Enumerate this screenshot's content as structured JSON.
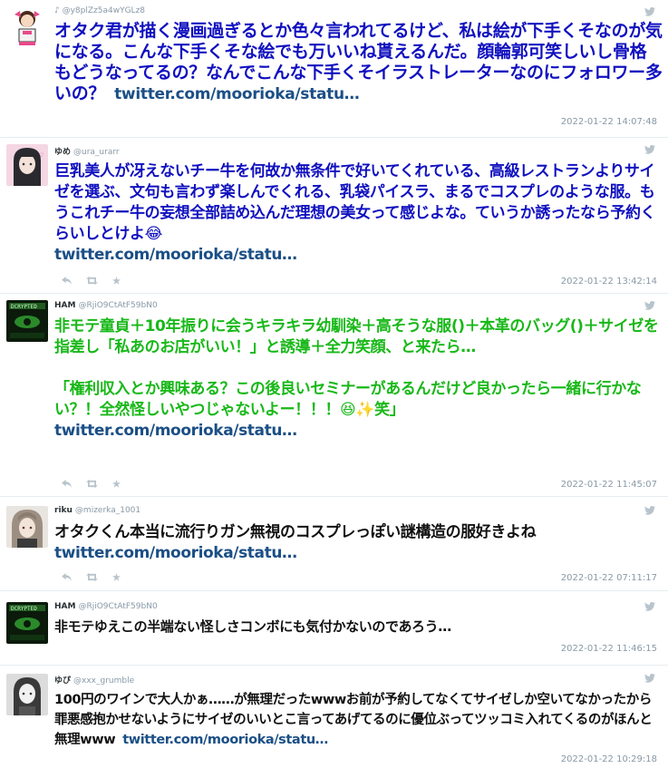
{
  "tweets": [
    {
      "name": "",
      "handle": "♪ @y8plZz5a4wYGLz8",
      "text": "オタク君が描く漫画過ぎるとか色々言われてるけど、私は絵が下手くそなのが気になる。こんな下手くそな絵でも万いいね貰えるんだ。顔輪郭可笑しいし骨格もどうなってるの？なんでこんな下手くそイラストレーターなのにフォロワー多いの？",
      "link": "twitter.com/moorioka/statu…",
      "time": "2022-01-22 14:07:48",
      "text_color": "#1010c0"
    },
    {
      "name": "ゆめ",
      "handle": "@ura_urarr",
      "text": "巨乳美人が冴えないチー牛を何故か無条件で好いてくれている、高級レストランよりサイゼを選ぶ、文句も言わず楽しんでくれる、乳袋パイスラ、まるでコスプレのような服。もうこれチー牛の妄想全部詰め込んだ理想の美女って感じよな。ていうか誘ったなら予約くらいしとけよ😂",
      "link": "twitter.com/moorioka/statu…",
      "time": "2022-01-22 13:42:14",
      "text_color": "#1010c0"
    },
    {
      "name": "HAM",
      "handle": "@RjiO9CtAtF59bN0",
      "text": "非モテ童貞＋10年振りに会うキラキラ幼馴染＋高そうな服()＋本革のバッグ()＋サイゼを指差し「私あのお店がいい！」と誘導＋全力笑顔、と来たら…",
      "text2": "「権利収入とか興味ある？この後良いセミナーがあるんだけど良かったら一緒に行かない？！全然怪しいやつじゃないよー！！！😆✨笑」",
      "link": "twitter.com/moorioka/statu…",
      "time": "2022-01-22 11:45:07",
      "text_color": "#18b818"
    },
    {
      "name": "riku",
      "handle": "@mizerka_1001",
      "text": "オタクくん本当に流行りガン無視のコスプレっぽい謎構造の服好きよね",
      "link": "twitter.com/moorioka/statu…",
      "time": "2022-01-22 07:11:17",
      "text_color": "#111111"
    },
    {
      "name": "HAM",
      "handle": "@RjiO9CtAtF59bN0",
      "text": "非モテゆえこの半端ない怪しさコンボにも気付かないのであろう…",
      "link": "",
      "time": "2022-01-22 11:46:15",
      "text_color": "#111111"
    },
    {
      "name": "ゆぴ",
      "handle": "@xxx_grumble",
      "text": "100円のワインで大人かぁ……が無理だったwwwお前が予約してなくてサイゼしか空いてなかったから罪悪感抱かせないようにサイゼのいいとこ言ってあげてるのに優位ぶってツッコミ入れてくるのがほんと無理www",
      "link": "twitter.com/moorioka/statu…",
      "time": "2022-01-22 10:29:18",
      "text_color": "#111111"
    }
  ],
  "colors": {
    "link": "#1b4f86",
    "icon": "#b8c4cc",
    "time": "#8899a6"
  }
}
